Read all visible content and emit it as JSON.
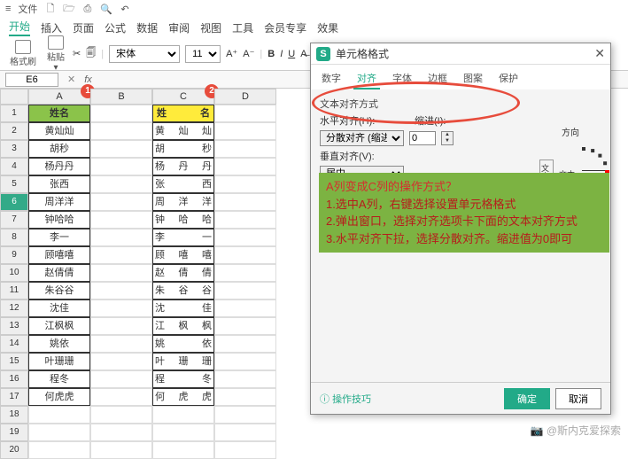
{
  "titlebar": {
    "menu_label": "文件"
  },
  "menubar": {
    "items": [
      "开始",
      "插入",
      "页面",
      "公式",
      "数据",
      "审阅",
      "视图",
      "工具",
      "会员专享",
      "效果"
    ],
    "active": 0
  },
  "toolbar": {
    "format_painter": "格式刷",
    "paste": "粘贴",
    "font_name": "宋体",
    "font_size": "11"
  },
  "formula": {
    "name_box": "E6",
    "fx": "fx"
  },
  "columns": [
    "A",
    "B",
    "C",
    "D"
  ],
  "badges": {
    "a": "1",
    "c": "2"
  },
  "header_a": "姓名",
  "header_c": {
    "left": "姓",
    "right": "名"
  },
  "rows": [
    {
      "a": "黄灿灿",
      "c": [
        "黄",
        "灿",
        "灿"
      ]
    },
    {
      "a": "胡秒",
      "c": [
        "胡",
        "",
        "秒"
      ]
    },
    {
      "a": "杨丹丹",
      "c": [
        "杨",
        "丹",
        "丹"
      ]
    },
    {
      "a": "张西",
      "c": [
        "张",
        "",
        "西"
      ]
    },
    {
      "a": "周洋洋",
      "c": [
        "周",
        "洋",
        "洋"
      ]
    },
    {
      "a": "钟哈哈",
      "c": [
        "钟",
        "哈",
        "哈"
      ]
    },
    {
      "a": "李一",
      "c": [
        "李",
        "",
        "一"
      ]
    },
    {
      "a": "顾嘻嘻",
      "c": [
        "顾",
        "嘻",
        "嘻"
      ]
    },
    {
      "a": "赵倩倩",
      "c": [
        "赵",
        "倩",
        "倩"
      ]
    },
    {
      "a": "朱谷谷",
      "c": [
        "朱",
        "谷",
        "谷"
      ]
    },
    {
      "a": "沈佳",
      "c": [
        "沈",
        "",
        "佳"
      ]
    },
    {
      "a": "江枫枫",
      "c": [
        "江",
        "枫",
        "枫"
      ]
    },
    {
      "a": "姚依",
      "c": [
        "姚",
        "",
        "依"
      ]
    },
    {
      "a": "叶珊珊",
      "c": [
        "叶",
        "珊",
        "珊"
      ]
    },
    {
      "a": "程冬",
      "c": [
        "程",
        "",
        "冬"
      ]
    },
    {
      "a": "何虎虎",
      "c": [
        "何",
        "虎",
        "虎"
      ]
    }
  ],
  "dialog": {
    "title": "单元格格式",
    "tabs": [
      "数字",
      "对齐",
      "字体",
      "边框",
      "图案",
      "保护"
    ],
    "active_tab": 1,
    "section_text_align": "文本对齐方式",
    "h_align_label": "水平对齐(H):",
    "h_align_value": "分散对齐 (缩进)",
    "indent_label": "缩进(I):",
    "indent_value": "0",
    "v_align_label": "垂直对齐(V):",
    "v_align_value": "居中",
    "direction_label": "方向",
    "direction_text_v": "文本",
    "direction_text_h": "文本",
    "tip": "操作技巧",
    "ok": "确定",
    "cancel": "取消"
  },
  "annotation": {
    "question": "A列变成C列的操作方式？",
    "step1": "1.选中A列，右键选择设置单元格格式",
    "step2": "2.弹出窗口，选择对齐选项卡下面的文本对齐方式",
    "step3": "3.水平对齐下拉，选择分散对齐。缩进值为0即可"
  },
  "watermark": "@斯内克爱探索"
}
